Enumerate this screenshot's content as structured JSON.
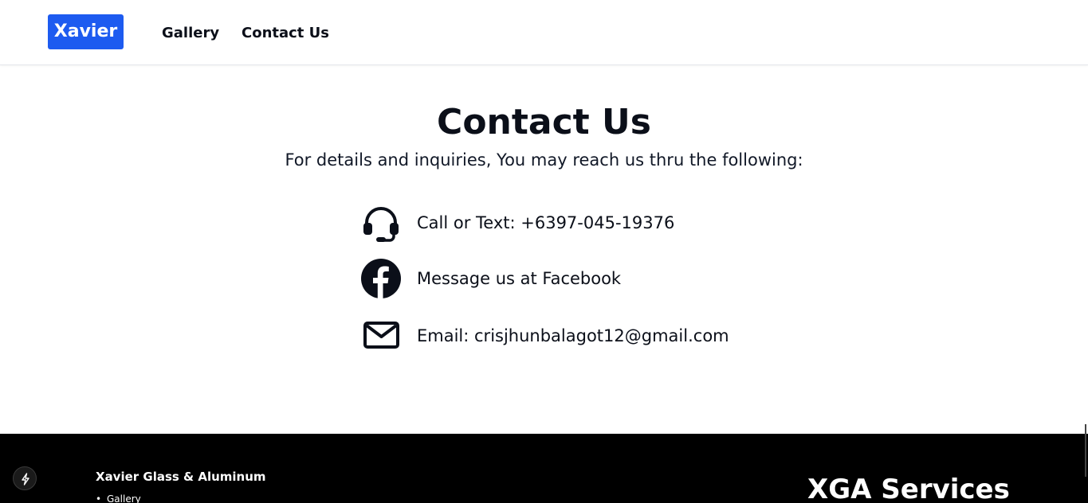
{
  "header": {
    "brand": "Xavier",
    "nav": [
      {
        "label": "Gallery"
      },
      {
        "label": "Contact Us"
      }
    ]
  },
  "main": {
    "title": "Contact Us",
    "subtitle": "For details and inquiries, You may reach us thru the following:",
    "contacts": [
      {
        "icon": "headset-icon",
        "label": "Call or Text: +6397-045-19376"
      },
      {
        "icon": "facebook-icon",
        "label": "Message us at Facebook"
      },
      {
        "icon": "mail-icon",
        "label": "Email: crisjhunbalagot12@gmail.com"
      }
    ]
  },
  "footer": {
    "brand": "Xavier Glass & Aluminum",
    "links": [
      "Gallery"
    ],
    "services_title": "XGA Services"
  },
  "colors": {
    "brand_blue": "#1d5bf0",
    "footer_bg": "#000000",
    "text": "#0b0f19"
  }
}
